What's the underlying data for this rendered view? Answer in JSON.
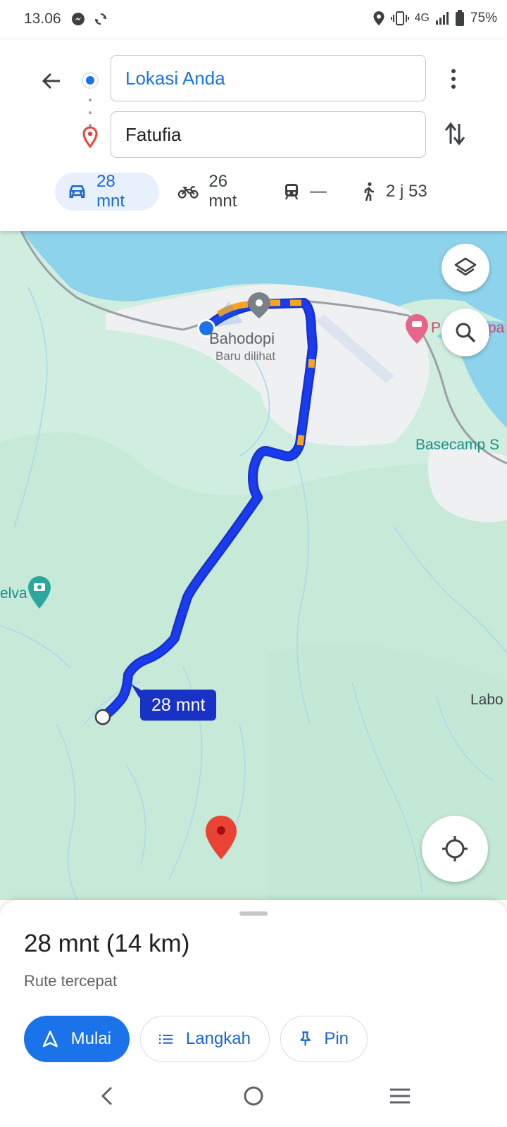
{
  "status_bar": {
    "time": "13.06",
    "network": "4G",
    "battery": "75%",
    "icons": [
      "messenger-icon",
      "sync-icon",
      "location-icon",
      "vibrate-icon",
      "signal-icon",
      "battery-icon"
    ]
  },
  "header": {
    "origin": "Lokasi Anda",
    "destination": "Fatufia",
    "modes": [
      {
        "name": "car",
        "label": "28 mnt",
        "active": true
      },
      {
        "name": "motorcycle",
        "label": "26 mnt",
        "active": false
      },
      {
        "name": "transit",
        "label": "—",
        "active": false
      },
      {
        "name": "walk",
        "label": "2 j 53",
        "active": false
      }
    ]
  },
  "map": {
    "labels": {
      "bahodopi": "Bahodopi",
      "baru_dilihat": "Baru dilihat",
      "basecamp": "Basecamp S",
      "elva": "elva",
      "labo": "Labo",
      "p": "P",
      "pa": "pa"
    },
    "duration_chip": "28 mnt",
    "colors": {
      "route": "#1a3cf0",
      "traffic": "#f4a623",
      "water": "#8dd3ec",
      "land": "#cfeee0",
      "urban": "#eef0f2"
    }
  },
  "sheet": {
    "title": "28 mnt (14 km)",
    "subtitle": "Rute tercepat",
    "start_label": "Mulai",
    "steps_label": "Langkah",
    "pin_label": "Pin"
  },
  "colors": {
    "accent": "#1a73e8",
    "active_mode_bg": "#e8f0fe",
    "dest_red": "#ea4335"
  }
}
